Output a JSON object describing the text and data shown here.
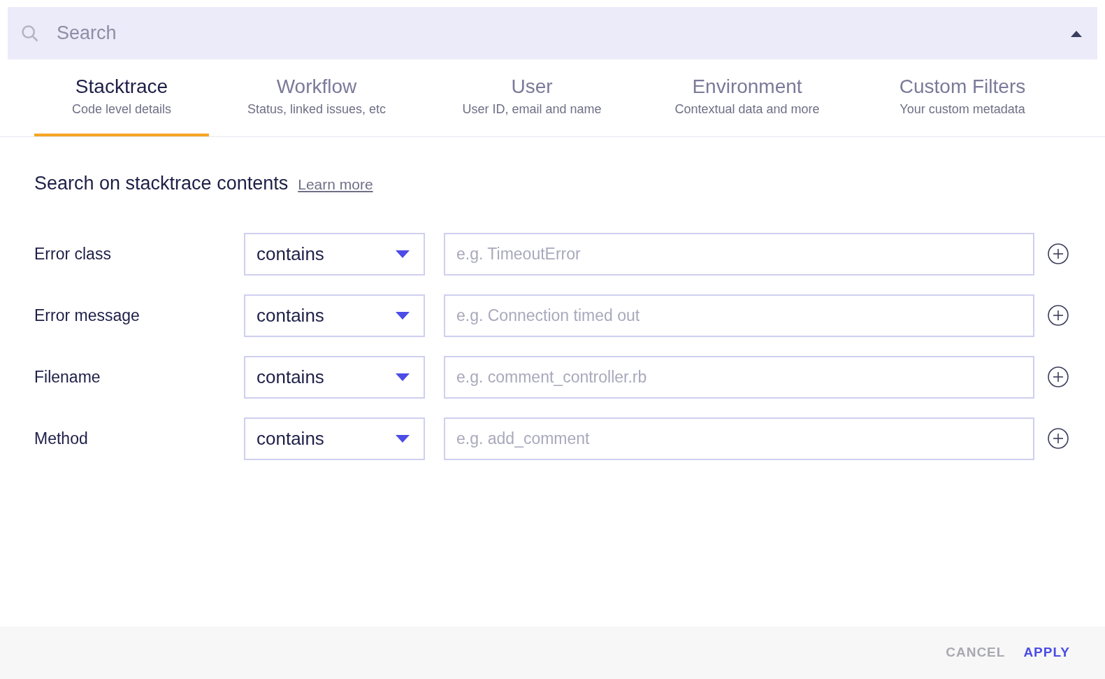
{
  "search": {
    "placeholder": "Search"
  },
  "tabs": [
    {
      "title": "Stacktrace",
      "subtitle": "Code level details",
      "selected": true
    },
    {
      "title": "Workflow",
      "subtitle": "Status, linked issues, etc",
      "selected": false
    },
    {
      "title": "User",
      "subtitle": "User ID, email and name",
      "selected": false
    },
    {
      "title": "Environment",
      "subtitle": "Contextual data and more",
      "selected": false
    },
    {
      "title": "Custom Filters",
      "subtitle": "Your custom metadata",
      "selected": false
    }
  ],
  "section": {
    "heading": "Search on stacktrace contents",
    "link": "Learn more"
  },
  "rows": [
    {
      "label": "Error class",
      "operator": "contains",
      "placeholder": "e.g. TimeoutError"
    },
    {
      "label": "Error message",
      "operator": "contains",
      "placeholder": "e.g. Connection timed out"
    },
    {
      "label": "Filename",
      "operator": "contains",
      "placeholder": "e.g. comment_controller.rb"
    },
    {
      "label": "Method",
      "operator": "contains",
      "placeholder": "e.g. add_comment"
    }
  ],
  "footer": [
    {
      "label": "CANCEL",
      "kind": "secondary"
    },
    {
      "label": "APPLY",
      "kind": "primary"
    }
  ]
}
